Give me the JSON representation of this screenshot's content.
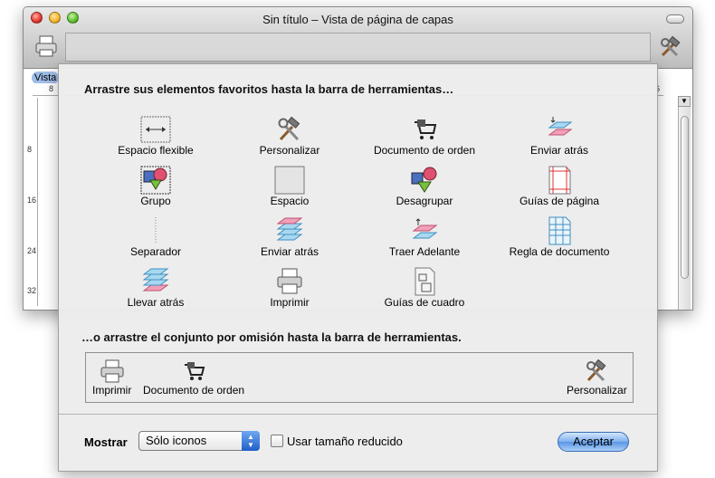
{
  "window": {
    "title": "Sin título – Vista de página de capas",
    "tab_label": "Vista",
    "ruler_top_labels": [
      "8",
      "6"
    ],
    "ruler_left_labels": [
      "8",
      "16",
      "24",
      "32"
    ]
  },
  "sheet": {
    "heading_palette": "Arrastre sus elementos favoritos hasta la barra de herramientas…",
    "palette_items": [
      {
        "label": "Espacio flexible",
        "icon": "flexible-space-icon"
      },
      {
        "label": "Personalizar",
        "icon": "tools-icon"
      },
      {
        "label": "Documento de orden",
        "icon": "shopping-cart-icon"
      },
      {
        "label": "Enviar atrás",
        "icon": "send-backward-icon"
      },
      {
        "label": "Grupo",
        "icon": "group-icon"
      },
      {
        "label": "Espacio",
        "icon": "space-icon"
      },
      {
        "label": "Desagrupar",
        "icon": "ungroup-icon"
      },
      {
        "label": "Guías de página",
        "icon": "page-guides-icon"
      },
      {
        "label": "Separador",
        "icon": "separator-icon"
      },
      {
        "label": "Enviar atrás",
        "icon": "send-to-back-icon"
      },
      {
        "label": "Traer Adelante",
        "icon": "bring-forward-icon"
      },
      {
        "label": "Regla de documento",
        "icon": "document-rule-icon"
      },
      {
        "label": "Llevar atrás",
        "icon": "send-to-back-icon"
      },
      {
        "label": "Imprimir",
        "icon": "printer-icon"
      },
      {
        "label": "Guías de cuadro",
        "icon": "box-guides-icon"
      }
    ],
    "heading_default": "…o arrastre el conjunto por omisión hasta la barra de herramientas.",
    "default_items": [
      {
        "label": "Imprimir",
        "icon": "printer-icon"
      },
      {
        "label": "Documento de orden",
        "icon": "shopping-cart-icon"
      },
      {
        "label": "Personalizar",
        "icon": "tools-icon"
      }
    ],
    "show_label": "Mostrar",
    "show_selected": "Sólo iconos",
    "small_size_label": "Usar tamaño reducido",
    "small_size_checked": false,
    "accept_label": "Aceptar"
  },
  "colors": {
    "accent": "#5a96e6",
    "selection": "#9fbde8"
  }
}
